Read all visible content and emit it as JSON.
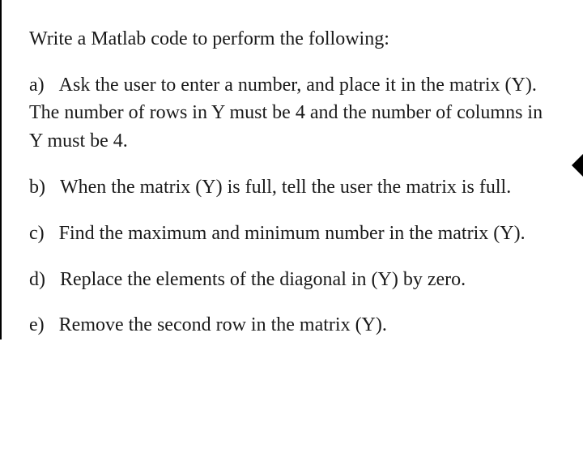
{
  "title": "Write a Matlab code to perform the following:",
  "items": [
    {
      "label": "a)",
      "text": "Ask the user to enter a number, and place it in the matrix (Y). The number of rows in Y must be 4 and the number of columns in Y must be 4."
    },
    {
      "label": "b)",
      "text": "When the matrix (Y) is full, tell the user the matrix is full."
    },
    {
      "label": "c)",
      "text": "Find the maximum and minimum number in the matrix (Y)."
    },
    {
      "label": "d)",
      "text": "Replace the elements of the diagonal in (Y) by zero."
    },
    {
      "label": "e)",
      "text": "Remove the second row in the matrix (Y)."
    }
  ]
}
